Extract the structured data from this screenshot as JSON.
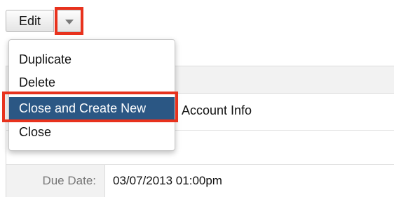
{
  "toolbar": {
    "edit_label": "Edit",
    "dropdown_icon": "caret-down-icon"
  },
  "menu": {
    "items": [
      {
        "label": "Duplicate"
      },
      {
        "label": "Delete"
      },
      {
        "label": "Close and Create New",
        "selected": true
      },
      {
        "label": "Close"
      }
    ]
  },
  "record": {
    "subject_value": "Account Info",
    "due_date_label": "Due Date:",
    "due_date_value": "03/07/2013 01:00pm"
  },
  "colors": {
    "selected_bg": "#2b5784",
    "highlight": "#e8321d"
  }
}
